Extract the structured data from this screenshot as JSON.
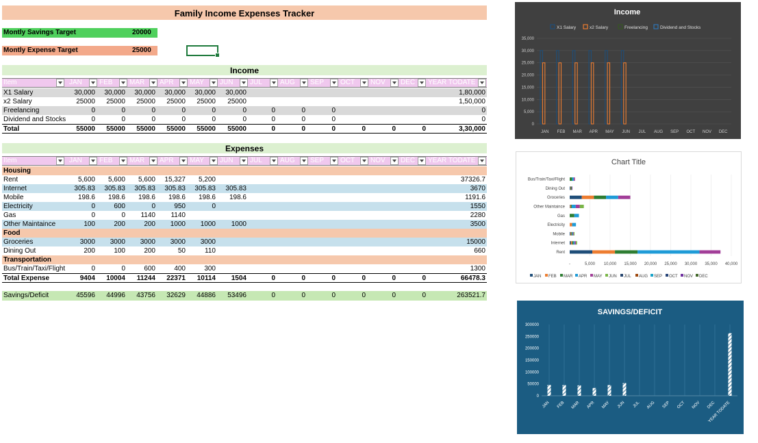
{
  "title": "Family Income Expenses Tracker",
  "targets": [
    {
      "label": "Montly Savings Target",
      "value": "20000",
      "color": "#4fd05c"
    },
    {
      "label": "Montly Expense Target",
      "value": "25000",
      "color": "#f3a98a"
    }
  ],
  "header_cols": [
    "Item",
    "JAN",
    "FEB",
    "MAR",
    "APR",
    "MAY",
    "JUN",
    "JUL",
    "AUG",
    "SEP",
    "OCT",
    "NOV",
    "DEC",
    "YEAR TODATE"
  ],
  "income": {
    "title": "Income",
    "rows": [
      {
        "item": "X1 Salary",
        "vals": [
          "30,000",
          "30,000",
          "30,000",
          "30,000",
          "30,000",
          "30,000",
          "",
          "",
          "",
          "",
          "",
          ""
        ],
        "ytd": "1,80,000",
        "shade": "#d9d9d9"
      },
      {
        "item": "x2 Salary",
        "vals": [
          "25000",
          "25000",
          "25000",
          "25000",
          "25000",
          "25000",
          "",
          "",
          "",
          "",
          "",
          ""
        ],
        "ytd": "1,50,000",
        "shade": "#ffffff"
      },
      {
        "item": "Freelancing",
        "vals": [
          "0",
          "0",
          "0",
          "0",
          "0",
          "0",
          "0",
          "0",
          "0",
          "",
          "",
          ""
        ],
        "ytd": "0",
        "shade": "#d9d9d9"
      },
      {
        "item": "Dividend and Stocks",
        "vals": [
          "0",
          "0",
          "0",
          "0",
          "0",
          "0",
          "0",
          "0",
          "0",
          "",
          "",
          ""
        ],
        "ytd": "0",
        "shade": "#ffffff"
      }
    ],
    "total": {
      "item": "Total",
      "vals": [
        "55000",
        "55000",
        "55000",
        "55000",
        "55000",
        "55000",
        "0",
        "0",
        "0",
        "0",
        "0",
        "0"
      ],
      "ytd": "3,30,000"
    }
  },
  "expenses": {
    "title": "Expenses",
    "rows": [
      {
        "item": "Housing",
        "category": true,
        "shade": "#f6c8ac"
      },
      {
        "item": "Rent",
        "vals": [
          "5,600",
          "5,600",
          "5,600",
          "15,327",
          "5,200",
          "",
          "",
          "",
          "",
          "",
          "",
          ""
        ],
        "ytd": "37326.7",
        "shade": "#ffffff"
      },
      {
        "item": "Internet",
        "vals": [
          "305.83",
          "305.83",
          "305.83",
          "305.83",
          "305.83",
          "305.83",
          "",
          "",
          "",
          "",
          "",
          ""
        ],
        "ytd": "3670",
        "shade": "#c6e0ec"
      },
      {
        "item": "Mobile",
        "vals": [
          "198.6",
          "198.6",
          "198.6",
          "198.6",
          "198.6",
          "198.6",
          "",
          "",
          "",
          "",
          "",
          ""
        ],
        "ytd": "1191.6",
        "shade": "#ffffff"
      },
      {
        "item": "Electricity",
        "vals": [
          "0",
          "600",
          "0",
          "950",
          "0",
          "",
          "",
          "",
          "",
          "",
          "",
          ""
        ],
        "ytd": "1550",
        "shade": "#c6e0ec"
      },
      {
        "item": "Gas",
        "vals": [
          "0",
          "0",
          "1140",
          "1140",
          "",
          "",
          "",
          "",
          "",
          "",
          "",
          ""
        ],
        "ytd": "2280",
        "shade": "#ffffff"
      },
      {
        "item": "Other Maintaince",
        "vals": [
          "100",
          "200",
          "200",
          "1000",
          "1000",
          "1000",
          "",
          "",
          "",
          "",
          "",
          ""
        ],
        "ytd": "3500",
        "shade": "#c6e0ec"
      },
      {
        "item": "Food",
        "category": true,
        "shade": "#f6c8ac"
      },
      {
        "item": "Groceries",
        "vals": [
          "3000",
          "3000",
          "3000",
          "3000",
          "3000",
          "",
          "",
          "",
          "",
          "",
          "",
          ""
        ],
        "ytd": "15000",
        "shade": "#c6e0ec"
      },
      {
        "item": "Dining Out",
        "vals": [
          "200",
          "100",
          "200",
          "50",
          "110",
          "",
          "",
          "",
          "",
          "",
          "",
          ""
        ],
        "ytd": "660",
        "shade": "#ffffff"
      },
      {
        "item": "Transportation",
        "category": true,
        "shade": "#f6c8ac"
      },
      {
        "item": "Bus/Train/Taxi/Flight",
        "vals": [
          "0",
          "0",
          "600",
          "400",
          "300",
          "",
          "",
          "",
          "",
          "",
          "",
          ""
        ],
        "ytd": "1300",
        "shade": "#ffffff"
      }
    ],
    "total": {
      "item": "Total Expense",
      "vals": [
        "9404",
        "10004",
        "11244",
        "22371",
        "10114",
        "1504",
        "0",
        "0",
        "0",
        "0",
        "0",
        "0"
      ],
      "ytd": "66478.3"
    }
  },
  "savings": {
    "item": "Savings/Deficit",
    "vals": [
      "45596",
      "44996",
      "43756",
      "32629",
      "44886",
      "53496",
      "0",
      "0",
      "0",
      "0",
      "0",
      "0"
    ],
    "ytd": "263521.7"
  },
  "chart_data": [
    {
      "type": "bar",
      "title": "Income",
      "categories": [
        "JAN",
        "FEB",
        "MAR",
        "APR",
        "MAY",
        "JUN",
        "JUL",
        "AUG",
        "SEP",
        "OCT",
        "NOV",
        "DEC"
      ],
      "series": [
        {
          "name": "X1 Salary",
          "color": "#1f4e79",
          "values": [
            30000,
            30000,
            30000,
            30000,
            30000,
            30000,
            0,
            0,
            0,
            0,
            0,
            0
          ]
        },
        {
          "name": "x2 Salary",
          "color": "#ed7d31",
          "values": [
            25000,
            25000,
            25000,
            25000,
            25000,
            25000,
            0,
            0,
            0,
            0,
            0,
            0
          ]
        },
        {
          "name": "Freelancing",
          "color": "#375623",
          "values": [
            0,
            0,
            0,
            0,
            0,
            0,
            0,
            0,
            0,
            0,
            0,
            0
          ]
        },
        {
          "name": "Dividend and Stocks",
          "color": "#2e75b6",
          "values": [
            0,
            0,
            0,
            0,
            0,
            0,
            0,
            0,
            0,
            0,
            0,
            0
          ]
        }
      ],
      "yticks": [
        "0",
        "5,000",
        "10,000",
        "15,000",
        "20,000",
        "25,000",
        "30,000",
        "35,000"
      ],
      "ylim": [
        0,
        35000
      ],
      "legend": "top"
    },
    {
      "type": "bar",
      "orientation": "horizontal-stacked",
      "title": "Chart Title",
      "categories": [
        "Rent",
        "Internet",
        "Mobile",
        "Electricity",
        "Gas",
        "Other Maintaince",
        "Groceries",
        "Dining Out",
        "Bus/Train/Taxi/Flight"
      ],
      "series": [
        {
          "name": "JAN",
          "color": "#1f4e79",
          "values": [
            5600,
            305.83,
            198.6,
            0,
            0,
            100,
            3000,
            200,
            0
          ]
        },
        {
          "name": "FEB",
          "color": "#ed7d31",
          "values": [
            5600,
            305.83,
            198.6,
            600,
            0,
            200,
            3000,
            100,
            0
          ]
        },
        {
          "name": "MAR",
          "color": "#2e7d32",
          "values": [
            5600,
            305.83,
            198.6,
            0,
            1140,
            200,
            3000,
            200,
            600
          ]
        },
        {
          "name": "APR",
          "color": "#1f9bd7",
          "values": [
            15327,
            305.83,
            198.6,
            950,
            1140,
            1000,
            3000,
            50,
            400
          ]
        },
        {
          "name": "MAY",
          "color": "#a23e98",
          "values": [
            5200,
            305.83,
            198.6,
            0,
            0,
            1000,
            3000,
            110,
            300
          ]
        },
        {
          "name": "JUN",
          "color": "#7ab648",
          "values": [
            0,
            305.83,
            198.6,
            0,
            0,
            1000,
            0,
            0,
            0
          ]
        },
        {
          "name": "JUL",
          "color": "#26456e",
          "values": [
            0,
            0,
            0,
            0,
            0,
            0,
            0,
            0,
            0
          ]
        },
        {
          "name": "AUG",
          "color": "#9e480e",
          "values": [
            0,
            0,
            0,
            0,
            0,
            0,
            0,
            0,
            0
          ]
        },
        {
          "name": "SEP",
          "color": "#17a3c9",
          "values": [
            0,
            0,
            0,
            0,
            0,
            0,
            0,
            0,
            0
          ]
        },
        {
          "name": "OCT",
          "color": "#264478",
          "values": [
            0,
            0,
            0,
            0,
            0,
            0,
            0,
            0,
            0
          ]
        },
        {
          "name": "NOV",
          "color": "#7030a0",
          "values": [
            0,
            0,
            0,
            0,
            0,
            0,
            0,
            0,
            0
          ]
        },
        {
          "name": "DEC",
          "color": "#43682b",
          "values": [
            0,
            0,
            0,
            0,
            0,
            0,
            0,
            0,
            0
          ]
        }
      ],
      "xticks": [
        "-",
        "5,000",
        "10,000",
        "15,000",
        "20,000",
        "25,000",
        "30,000",
        "35,000",
        "40,000"
      ],
      "xlim": [
        0,
        40000
      ],
      "legend": "bottom"
    },
    {
      "type": "bar",
      "title": "SAVINGS/DEFICIT",
      "categories": [
        "JAN",
        "FEB",
        "MAR",
        "APR",
        "MAY",
        "JUN",
        "JUL",
        "AUG",
        "SEP",
        "OCT",
        "NOV",
        "DEC",
        "YEAR TODATE"
      ],
      "values": [
        45596,
        44996,
        43756,
        32629,
        44886,
        53496,
        0,
        0,
        0,
        0,
        0,
        0,
        263521.7
      ],
      "yticks": [
        "0",
        "50000",
        "100000",
        "150000",
        "200000",
        "250000",
        "300000"
      ],
      "ylim": [
        0,
        300000
      ]
    }
  ]
}
